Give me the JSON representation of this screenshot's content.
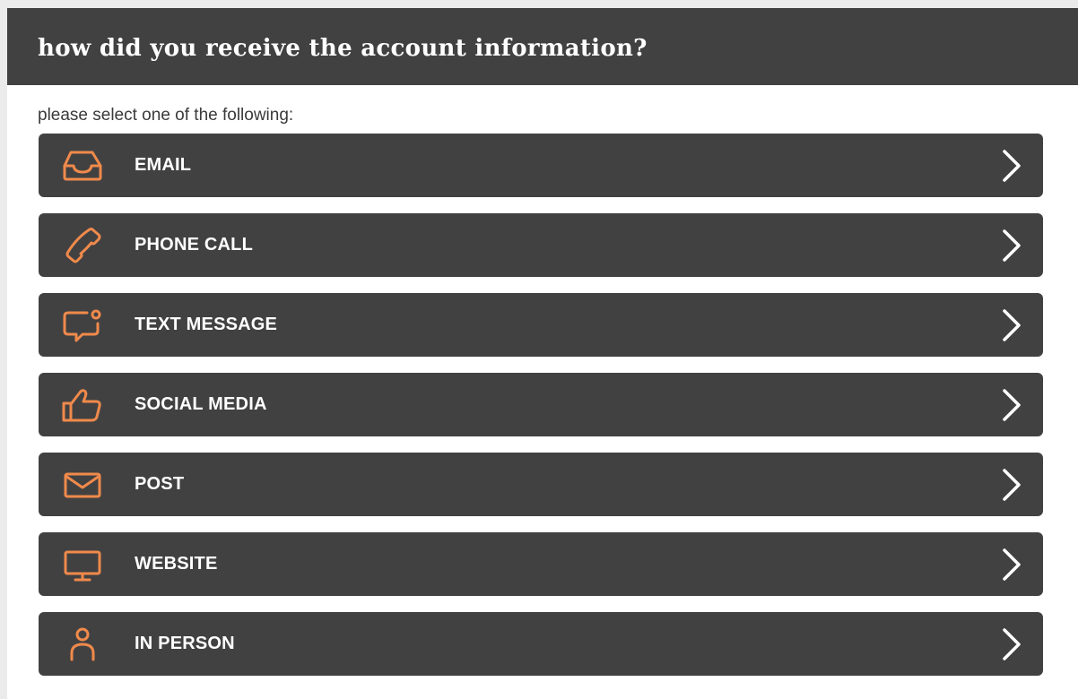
{
  "header": {
    "title": "how did you receive the account information?"
  },
  "prompt": "please select one of the following:",
  "accent_color": "#f08a4b",
  "options": [
    {
      "label": "EMAIL",
      "icon": "inbox-tray-icon"
    },
    {
      "label": "PHONE CALL",
      "icon": "phone-icon"
    },
    {
      "label": "TEXT MESSAGE",
      "icon": "chat-bubble-notification-icon"
    },
    {
      "label": "SOCIAL MEDIA",
      "icon": "thumbs-up-icon"
    },
    {
      "label": "POST",
      "icon": "envelope-icon"
    },
    {
      "label": "WEBSITE",
      "icon": "monitor-icon"
    },
    {
      "label": "IN PERSON",
      "icon": "person-icon"
    }
  ]
}
